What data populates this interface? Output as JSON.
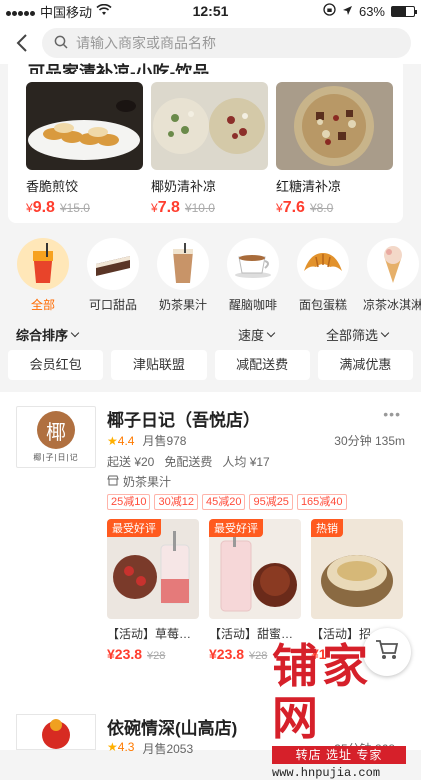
{
  "statusbar": {
    "carrier": "中国移动",
    "time": "12:51",
    "battery": "63%",
    "battery_level": 0.63
  },
  "search": {
    "placeholder": "请输入商家或商品名称"
  },
  "featured": {
    "title": "可品家清补凉-小吃-饮品",
    "products": [
      {
        "name": "香脆煎饺",
        "price_symbol": "¥",
        "price": "9.8",
        "old": "¥15.0",
        "image": "dumpling-image"
      },
      {
        "name": "椰奶清补凉",
        "price_symbol": "¥",
        "price": "7.8",
        "old": "¥10.0",
        "image": "coconut-dessert-image"
      },
      {
        "name": "红糖清补凉",
        "price_symbol": "¥",
        "price": "7.6",
        "old": "¥8.0",
        "image": "brown-sugar-dessert-image"
      }
    ]
  },
  "categories": [
    {
      "label": "全部",
      "icon": "drink-icon",
      "active": true
    },
    {
      "label": "可口甜品",
      "icon": "cake-icon",
      "active": false
    },
    {
      "label": "奶茶果汁",
      "icon": "milk-tea-icon",
      "active": false
    },
    {
      "label": "醒脑咖啡",
      "icon": "coffee-icon",
      "active": false
    },
    {
      "label": "面包蛋糕",
      "icon": "croissant-icon",
      "active": false
    },
    {
      "label": "凉茶冰淇淋",
      "icon": "ice-cream-icon",
      "active": false
    }
  ],
  "sort": {
    "overall": "综合排序",
    "speed": "速度",
    "filter": "全部筛选"
  },
  "filters": [
    "会员红包",
    "津贴联盟",
    "减配送费",
    "满减优惠"
  ],
  "shop": {
    "logo_char": "椰",
    "logo_sub": "椰|子|日|记",
    "name": "椰子日记（吾悦店）",
    "more": "•••",
    "score": "4.4",
    "monthly_sales": "月售978",
    "delivery_time": "30分钟",
    "distance": "135m",
    "min_order": "起送 ¥20",
    "free_delivery": "免配送费",
    "per_person": "人均 ¥17",
    "category": "奶茶果汁",
    "promos": [
      "25减10",
      "30减12",
      "45减20",
      "95减25",
      "165减40"
    ],
    "dishes": [
      {
        "badge": "最受好评",
        "name": "【活动】草莓…",
        "price": "¥23.8",
        "old": "¥28"
      },
      {
        "badge": "最受好评",
        "name": "【活动】甜蜜…",
        "price": "¥23.8",
        "old": "¥28"
      },
      {
        "badge": "热销",
        "name": "【活动】招…",
        "price": "¥1",
        "old": ""
      }
    ]
  },
  "shop2": {
    "name": "依碗情深(山高店)",
    "score": "4.3",
    "monthly_sales": "月售2053",
    "delivery_time": "35分钟",
    "distance": "868m"
  },
  "watermark": {
    "brand": "铺家网",
    "slogan": "转店 选址 专家",
    "url": "www.hnpujia.com"
  },
  "colors": {
    "accent": "#ff6a00",
    "price": "#ff3d2e",
    "brand_red": "#d6202a"
  }
}
